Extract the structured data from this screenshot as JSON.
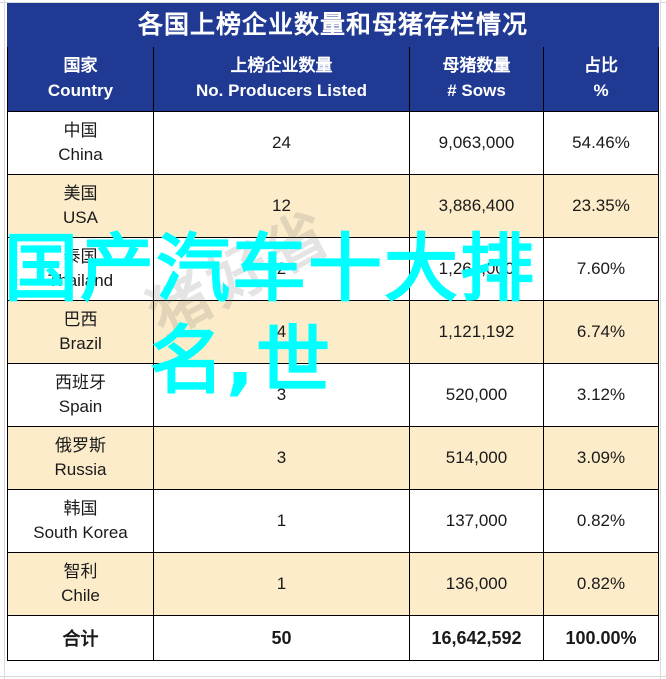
{
  "title": "各国上榜企业数量和母猪存栏情况",
  "columns": [
    {
      "zh": "国家",
      "en": "Country"
    },
    {
      "zh": "上榜企业数量",
      "en": "No. Producers Listed"
    },
    {
      "zh": "母猪数量",
      "en": "# Sows"
    },
    {
      "zh": "占比",
      "en": "%"
    }
  ],
  "rows": [
    {
      "zh": "中国",
      "en": "China",
      "producers": "24",
      "sows": "9,063,000",
      "share": "54.46%"
    },
    {
      "zh": "美国",
      "en": "USA",
      "producers": "12",
      "sows": "3,886,400",
      "share": "23.35%"
    },
    {
      "zh": "泰国",
      "en": "Thailand",
      "producers": "2",
      "sows": "1,265,000",
      "share": "7.60%"
    },
    {
      "zh": "巴西",
      "en": "Brazil",
      "producers": "4",
      "sows": "1,121,192",
      "share": "6.74%"
    },
    {
      "zh": "西班牙",
      "en": "Spain",
      "producers": "3",
      "sows": "520,000",
      "share": "3.12%"
    },
    {
      "zh": "俄罗斯",
      "en": "Russia",
      "producers": "3",
      "sows": "514,000",
      "share": "3.09%"
    },
    {
      "zh": "韩国",
      "en": "South Korea",
      "producers": "1",
      "sows": "137,000",
      "share": "0.82%"
    },
    {
      "zh": "智利",
      "en": "Chile",
      "producers": "1",
      "sows": "136,000",
      "share": "0.82%"
    }
  ],
  "total": {
    "label": "合计",
    "producers": "50",
    "sows": "16,642,592",
    "share": "100.00%"
  },
  "overlay": {
    "line1": "国产汽车十大排",
    "line2": "名,世",
    "color": "#00FFFF"
  },
  "grey_watermark": "猪好省",
  "colors": {
    "header_blue": "#203A93",
    "row_beige": "#FCECC9",
    "row_white": "#FFFFFF",
    "border": "#000000"
  }
}
